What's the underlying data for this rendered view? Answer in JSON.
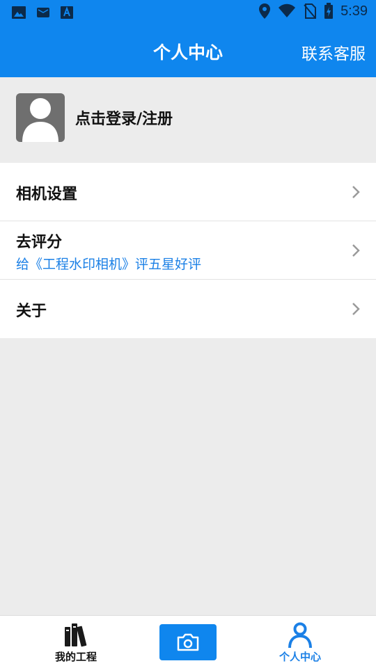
{
  "status_bar": {
    "time": "5:39",
    "left_icons": [
      "image-icon",
      "mail-icon",
      "font-icon"
    ],
    "right_icons": [
      "location-icon",
      "wifi-icon",
      "no-sim-icon",
      "battery-charging-icon"
    ]
  },
  "header": {
    "title": "个人中心",
    "action_label": "联系客服",
    "color": "#0f86ee"
  },
  "profile": {
    "avatar_icon": "avatar-icon",
    "login_label": "点击登录/注册"
  },
  "menu": {
    "items": [
      {
        "title": "相机设置"
      },
      {
        "title": "去评分",
        "subtitle": "给《工程水印相机》评五星好评"
      },
      {
        "title": "关于"
      }
    ]
  },
  "bottom_nav": {
    "tabs": [
      {
        "label": "我的工程",
        "icon": "books-icon",
        "active": false
      },
      {
        "label": "",
        "icon": "camera-icon",
        "active": false
      },
      {
        "label": "个人中心",
        "icon": "person-icon",
        "active": true
      }
    ],
    "active_color": "#1b80e6"
  }
}
